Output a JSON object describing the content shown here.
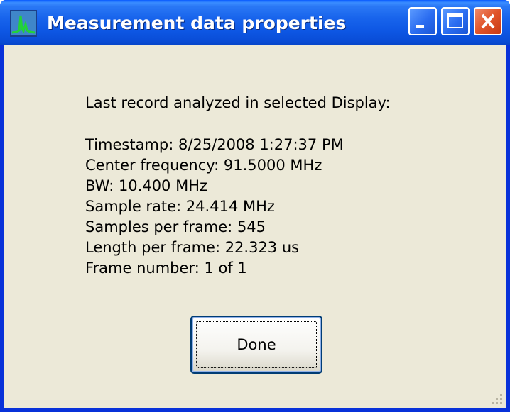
{
  "window": {
    "title": "Measurement data properties",
    "icons": {
      "app": "spectrum-app-icon",
      "minimize": "minimize-icon",
      "maximize": "maximize-icon",
      "close": "close-icon",
      "resize": "resize-grip-icon"
    },
    "colors": {
      "titlebar": "#0a4ed8",
      "client_background": "#ece9d8",
      "close_button": "#e0542a"
    }
  },
  "content": {
    "heading": "Last record analyzed in selected Display:",
    "properties": [
      "Timestamp: 8/25/2008 1:27:37 PM",
      "Center frequency: 91.5000 MHz",
      "BW: 10.400 MHz",
      "Sample rate: 24.414 MHz",
      "Samples per frame: 545",
      "Length per frame: 22.323 us",
      "Frame number: 1 of 1"
    ]
  },
  "buttons": {
    "done_label": "Done"
  }
}
